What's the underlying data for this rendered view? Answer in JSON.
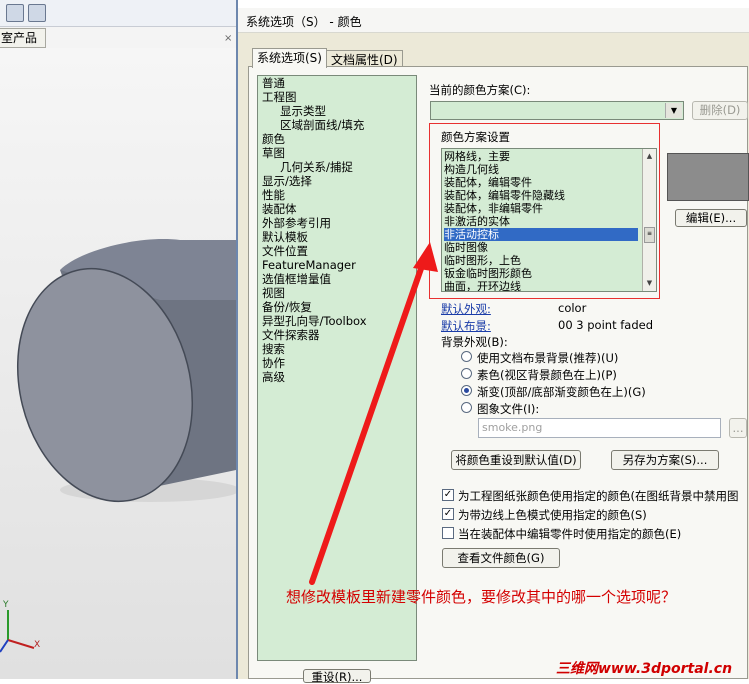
{
  "viewport": {
    "tab_label": "室产品",
    "close_glyph": "×",
    "axes": {
      "y": "Y",
      "x": "X"
    }
  },
  "dialog": {
    "title": "系统选项（S） - 颜色",
    "tabs": [
      "系统选项(S)",
      "文档属性(D)"
    ],
    "tree": [
      {
        "label": "普通",
        "level": 0
      },
      {
        "label": "工程图",
        "level": 0
      },
      {
        "label": "显示类型",
        "level": 1
      },
      {
        "label": "区域剖面线/填充",
        "level": 1
      },
      {
        "label": "颜色",
        "level": 0
      },
      {
        "label": "草图",
        "level": 0
      },
      {
        "label": "几何关系/捕捉",
        "level": 1
      },
      {
        "label": "显示/选择",
        "level": 0
      },
      {
        "label": "性能",
        "level": 0
      },
      {
        "label": "装配体",
        "level": 0
      },
      {
        "label": "外部参考引用",
        "level": 0
      },
      {
        "label": "默认模板",
        "level": 0
      },
      {
        "label": "文件位置",
        "level": 0
      },
      {
        "label": "FeatureManager",
        "level": 0
      },
      {
        "label": "选值框增量值",
        "level": 0
      },
      {
        "label": "视图",
        "level": 0
      },
      {
        "label": "备份/恢复",
        "level": 0
      },
      {
        "label": "异型孔向导/Toolbox",
        "level": 0
      },
      {
        "label": "文件探索器",
        "level": 0
      },
      {
        "label": "搜索",
        "level": 0
      },
      {
        "label": "协作",
        "level": 0
      },
      {
        "label": "高级",
        "level": 0
      }
    ],
    "reset_button": "重设(R)...",
    "scheme_label": "当前的颜色方案(C):",
    "scheme_value": "",
    "delete_button": "删除(D)",
    "settings_label": "颜色方案设置",
    "color_items": [
      "网格线，主要",
      "构造几何线",
      "装配体，编辑零件",
      "装配体，编辑零件隐藏线",
      "装配体，非编辑零件",
      "非激活的实体",
      "非活动控标",
      "临时图像",
      "临时图形，上色",
      "钣金临时图形颜色",
      "曲面，开环边线"
    ],
    "selected_index": 6,
    "edit_button": "编辑(E)...",
    "default_appearance_label": "默认外观:",
    "default_appearance_value": "color",
    "default_scene_label": "默认布景:",
    "default_scene_value": "00 3 point faded",
    "background_label": "背景外观(B):",
    "bg_options": [
      {
        "label": "使用文档布景背景(推荐)(U)",
        "checked": false
      },
      {
        "label": "素色(视区背景颜色在上)(P)",
        "checked": false
      },
      {
        "label": "渐变(顶部/底部渐变颜色在上)(G)",
        "checked": true
      },
      {
        "label": "图象文件(I):",
        "checked": false
      }
    ],
    "image_file_value": "smoke.png",
    "browse_button": "...",
    "reset_colors_button": "将颜色重设到默认值(D)",
    "save_scheme_button": "另存为方案(S)...",
    "checkboxes": [
      {
        "label": "为工程图纸张颜色使用指定的颜色(在图纸背景中禁用图",
        "checked": true
      },
      {
        "label": "为带边线上色模式使用指定的颜色(S)",
        "checked": true
      },
      {
        "label": "当在装配体中编辑零件时使用指定的颜色(E)",
        "checked": false
      }
    ],
    "view_file_colors_button": "查看文件颜色(G)"
  },
  "annotation": "想修改模板里新建零件颜色，要修改其中的哪一个选项呢？",
  "watermark": "三维网www.3dportal.cn",
  "colors": {
    "tree_bg": "#d4ecd4",
    "selection": "#316ac5",
    "annotation_red": "#e83030",
    "swatch": "#8c8c8c"
  }
}
